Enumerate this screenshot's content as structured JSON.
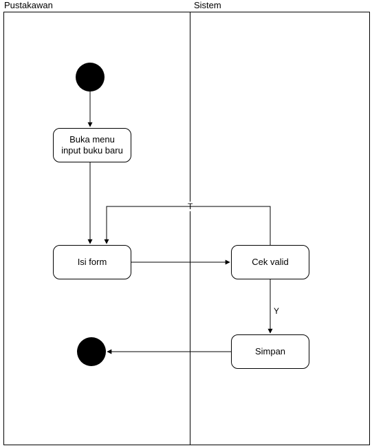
{
  "diagram": {
    "type": "activity-diagram",
    "swimlanes": [
      {
        "id": "pustakawan",
        "label": "Pustakawan"
      },
      {
        "id": "sistem",
        "label": "Sistem"
      }
    ],
    "nodes": {
      "start": {
        "kind": "initial",
        "lane": "pustakawan"
      },
      "buka_menu": {
        "kind": "activity",
        "lane": "pustakawan",
        "label": "Buka menu\ninput buku baru"
      },
      "isi_form": {
        "kind": "activity",
        "lane": "pustakawan",
        "label": "Isi form"
      },
      "cek_valid": {
        "kind": "activity",
        "lane": "sistem",
        "label": "Cek valid"
      },
      "simpan": {
        "kind": "activity",
        "lane": "sistem",
        "label": "Simpan"
      },
      "end": {
        "kind": "final",
        "lane": "pustakawan"
      }
    },
    "edges": [
      {
        "from": "start",
        "to": "buka_menu"
      },
      {
        "from": "buka_menu",
        "to": "isi_form"
      },
      {
        "from": "isi_form",
        "to": "cek_valid"
      },
      {
        "from": "cek_valid",
        "to": "isi_form",
        "label": "T"
      },
      {
        "from": "cek_valid",
        "to": "simpan",
        "label": "Y"
      },
      {
        "from": "simpan",
        "to": "end"
      }
    ],
    "edge_labels": {
      "t": "T",
      "y": "Y"
    }
  }
}
